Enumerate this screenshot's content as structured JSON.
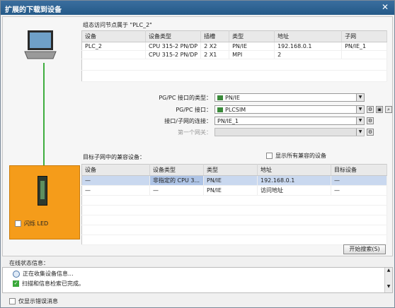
{
  "window": {
    "title": "扩展的下载到设备",
    "close": "✕"
  },
  "config": {
    "heading": "组态访问节点属于 \"PLC_2\"",
    "columns": [
      "设备",
      "设备类型",
      "插槽",
      "类型",
      "地址",
      "子网"
    ],
    "rows": [
      [
        "PLC_2",
        "CPU 315-2 PN/DP",
        "2 X2",
        "PN/IE",
        "192.168.0.1",
        "PN/IE_1"
      ],
      [
        "",
        "CPU 315-2 PN/DP",
        "2 X1",
        "MPI",
        "2",
        ""
      ]
    ]
  },
  "form": {
    "iface_type_label": "PG/PC 接口的类型：",
    "iface_type_value": "PN/IE",
    "iface_label": "PG/PC 接口：",
    "iface_value": "PLCSIM",
    "subnet_label": "接口/子网的连接：",
    "subnet_value": "PN/IE_1",
    "gateway_label": "第一个网关：",
    "gateway_value": ""
  },
  "target": {
    "heading": "目标子网中的兼容设备：",
    "show_all_label": "显示所有兼容的设备",
    "columns": [
      "设备",
      "设备类型",
      "类型",
      "地址",
      "目标设备"
    ],
    "rows": [
      [
        "—",
        "非指定的 CPU 3...",
        "PN/IE",
        "192.168.0.1",
        "—"
      ],
      [
        "—",
        "—",
        "PN/IE",
        "访问地址",
        "—"
      ]
    ]
  },
  "flash_led_label": "闪烁 LED",
  "start_search_label": "开始搜索(S)",
  "status": {
    "heading": "在线状态信息：",
    "items": [
      "正在收集设备信息...",
      "扫描和信息检索已完成。"
    ]
  },
  "errors_only_label": "仅显示错误消息",
  "colors": {
    "titlebar": "#2e6494",
    "orange": "#f59c1a",
    "link": "#3fae3f",
    "selection": "#c9d8ef"
  }
}
